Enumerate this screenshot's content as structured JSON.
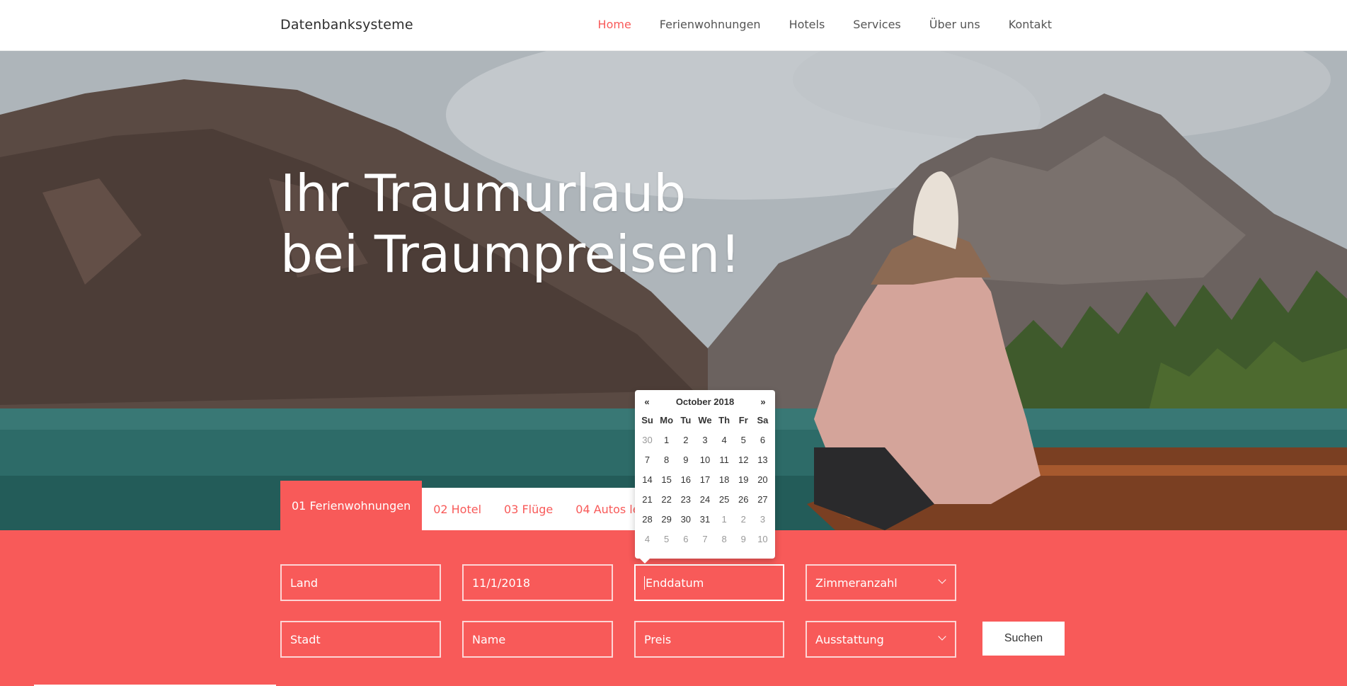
{
  "navbar": {
    "brand": "Datenbanksysteme",
    "items": [
      {
        "label": "Home",
        "active": true
      },
      {
        "label": "Ferienwohnungen",
        "active": false
      },
      {
        "label": "Hotels",
        "active": false
      },
      {
        "label": "Services",
        "active": false
      },
      {
        "label": "Über uns",
        "active": false
      },
      {
        "label": "Kontakt",
        "active": false
      }
    ]
  },
  "hero": {
    "headline_line1": "Ihr Traumurlaub",
    "headline_line2": "bei Traumpreisen!"
  },
  "tabs": [
    {
      "label": "01 Ferienwohnungen",
      "active": true
    },
    {
      "label": "02 Hotel",
      "active": false
    },
    {
      "label": "03 Flüge",
      "active": false
    },
    {
      "label": "04 Autos leihen",
      "active": false
    }
  ],
  "form": {
    "land_placeholder": "Land",
    "start_date_value": "11/1/2018",
    "end_date_placeholder": "Enddatum",
    "rooms_placeholder": "Zimmeranzahl",
    "city_placeholder": "Stadt",
    "name_placeholder": "Name",
    "price_placeholder": "Preis",
    "features_placeholder": "Ausstattung",
    "search_label": "Suchen"
  },
  "datepicker": {
    "prev": "«",
    "next": "»",
    "month_label": "October 2018",
    "weekdays": [
      "Su",
      "Mo",
      "Tu",
      "We",
      "Th",
      "Fr",
      "Sa"
    ],
    "weeks": [
      [
        {
          "d": "30",
          "muted": true
        },
        {
          "d": "1"
        },
        {
          "d": "2"
        },
        {
          "d": "3"
        },
        {
          "d": "4"
        },
        {
          "d": "5"
        },
        {
          "d": "6"
        }
      ],
      [
        {
          "d": "7"
        },
        {
          "d": "8"
        },
        {
          "d": "9"
        },
        {
          "d": "10"
        },
        {
          "d": "11"
        },
        {
          "d": "12"
        },
        {
          "d": "13"
        }
      ],
      [
        {
          "d": "14"
        },
        {
          "d": "15"
        },
        {
          "d": "16"
        },
        {
          "d": "17"
        },
        {
          "d": "18"
        },
        {
          "d": "19"
        },
        {
          "d": "20"
        }
      ],
      [
        {
          "d": "21"
        },
        {
          "d": "22"
        },
        {
          "d": "23"
        },
        {
          "d": "24"
        },
        {
          "d": "25"
        },
        {
          "d": "26"
        },
        {
          "d": "27"
        }
      ],
      [
        {
          "d": "28"
        },
        {
          "d": "29"
        },
        {
          "d": "30"
        },
        {
          "d": "31"
        },
        {
          "d": "1",
          "muted": true
        },
        {
          "d": "2",
          "muted": true
        },
        {
          "d": "3",
          "muted": true
        }
      ],
      [
        {
          "d": "4",
          "muted": true
        },
        {
          "d": "5",
          "muted": true
        },
        {
          "d": "6",
          "muted": true
        },
        {
          "d": "7",
          "muted": true
        },
        {
          "d": "8",
          "muted": true
        },
        {
          "d": "9",
          "muted": true
        },
        {
          "d": "10",
          "muted": true
        }
      ]
    ]
  },
  "colors": {
    "accent": "#f85a59",
    "text_dark": "#2e2e2e",
    "nav_text": "#555555"
  }
}
